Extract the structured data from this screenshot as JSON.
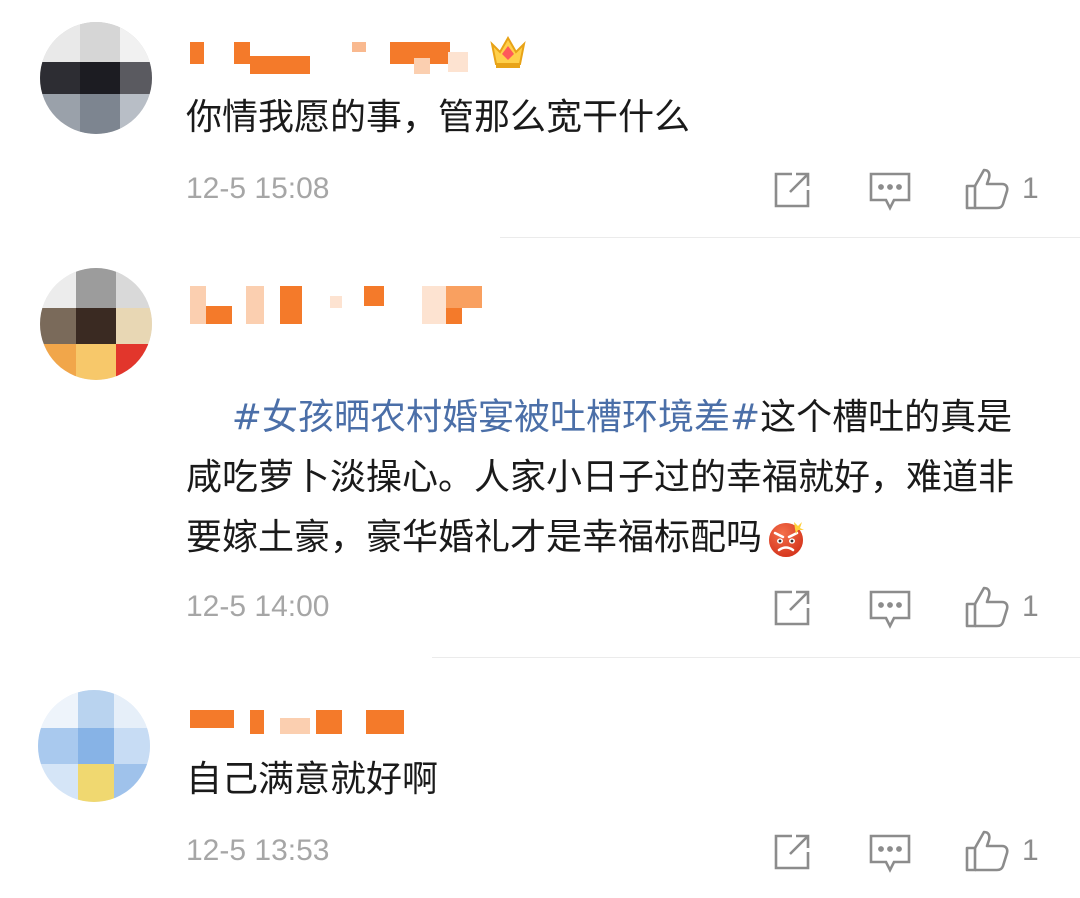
{
  "comments": [
    {
      "text": "你情我愿的事，管那么宽干什么",
      "time": "12-5 15:08",
      "likes": "1",
      "has_vip_crown": true
    },
    {
      "hashtag": "#女孩晒农村婚宴被吐槽环境差#",
      "text": "这个槽吐的真是咸吃萝卜淡操心。人家小日子过的幸福就好，难道非要嫁土豪，豪华婚礼才是幸福标配吗",
      "emoji": "angry-face",
      "time": "12-5 14:00",
      "likes": "1"
    },
    {
      "text": "自己满意就好啊",
      "time": "12-5 13:53",
      "likes": "1"
    }
  ],
  "icons": {
    "share": "share-icon",
    "reply": "comment-icon",
    "like": "thumbs-up-icon"
  },
  "colors": {
    "hashtag": "#4b6fa8",
    "timestamp": "#a6a6a6",
    "icon": "#8c8c8c",
    "username_redacted": "#f47a2a"
  }
}
